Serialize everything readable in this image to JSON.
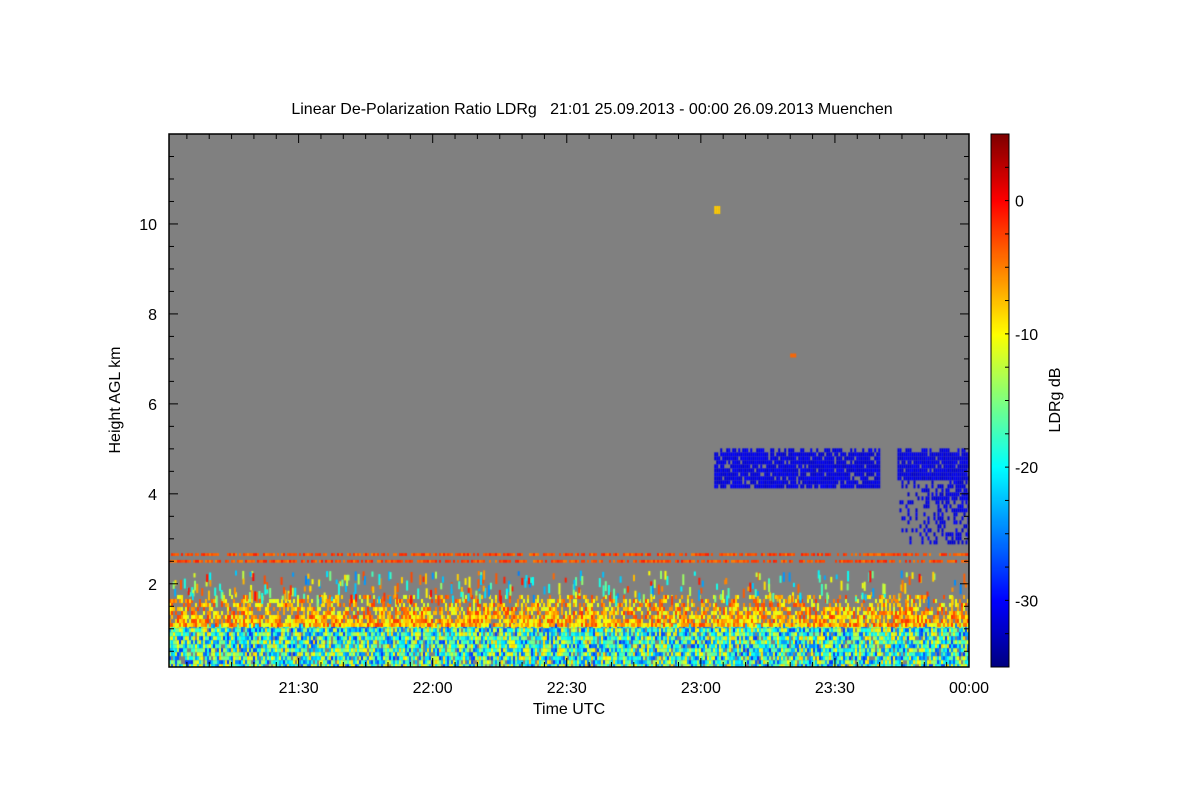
{
  "chart_data": {
    "type": "heatmap",
    "title": "Linear De-Polarization Ratio LDRg   21:01 25.09.2013 - 00:00 26.09.2013 Muenchen",
    "xlabel": "Time UTC",
    "ylabel": "Height AGL km",
    "colorbar_label": "LDRg dB",
    "xlim": [
      "21:01",
      "00:00"
    ],
    "x_ticks": [
      "21:30",
      "22:00",
      "22:30",
      "23:00",
      "23:30",
      "00:00"
    ],
    "ylim": [
      0.15,
      12
    ],
    "y_ticks": [
      2,
      4,
      6,
      8,
      10
    ],
    "clim": [
      -35,
      5
    ],
    "colorbar_ticks": [
      0,
      -10,
      -20,
      -30
    ],
    "colormap": "jet",
    "no_data_color": "#808080",
    "features": [
      {
        "name": "boundary layer (lower part)",
        "t_start": "21:01",
        "t_end": "00:00",
        "h_min": 0.15,
        "h_max": 1.1,
        "ldr_range": [
          -28,
          -8
        ]
      },
      {
        "name": "boundary layer (upper part)",
        "t_start": "21:01",
        "t_end": "00:00",
        "h_min": 1.1,
        "h_max": 1.75,
        "ldr_range": [
          -12,
          -2
        ]
      },
      {
        "name": "layer",
        "t_start": "21:01",
        "t_end": "00:00",
        "h_min": 2.62,
        "h_max": 2.68,
        "ldr_range": [
          -5,
          -1
        ]
      },
      {
        "name": "layer",
        "t_start": "21:01",
        "t_end": "00:00",
        "h_min": 2.47,
        "h_max": 2.53,
        "ldr_range": [
          -5,
          -1
        ]
      },
      {
        "name": "cloud",
        "t_start": "23:03",
        "t_end": "23:40",
        "h_min": 4.2,
        "h_max": 5.1,
        "ldr_range": [
          -32,
          -30
        ]
      },
      {
        "name": "cloud",
        "t_start": "23:44",
        "t_end": "00:00",
        "h_min": 2.9,
        "h_max": 5.1,
        "ldr_range": [
          -32,
          -30
        ]
      },
      {
        "name": "point",
        "t_start": "23:03",
        "t_end": "23:04",
        "h_min": 10.3,
        "h_max": 10.4,
        "ldr_range": [
          -8,
          -8
        ]
      },
      {
        "name": "point",
        "t_start": "23:20",
        "t_end": "23:21",
        "h_min": 7.05,
        "h_max": 7.12,
        "ldr_range": [
          -4,
          -4
        ]
      }
    ]
  }
}
